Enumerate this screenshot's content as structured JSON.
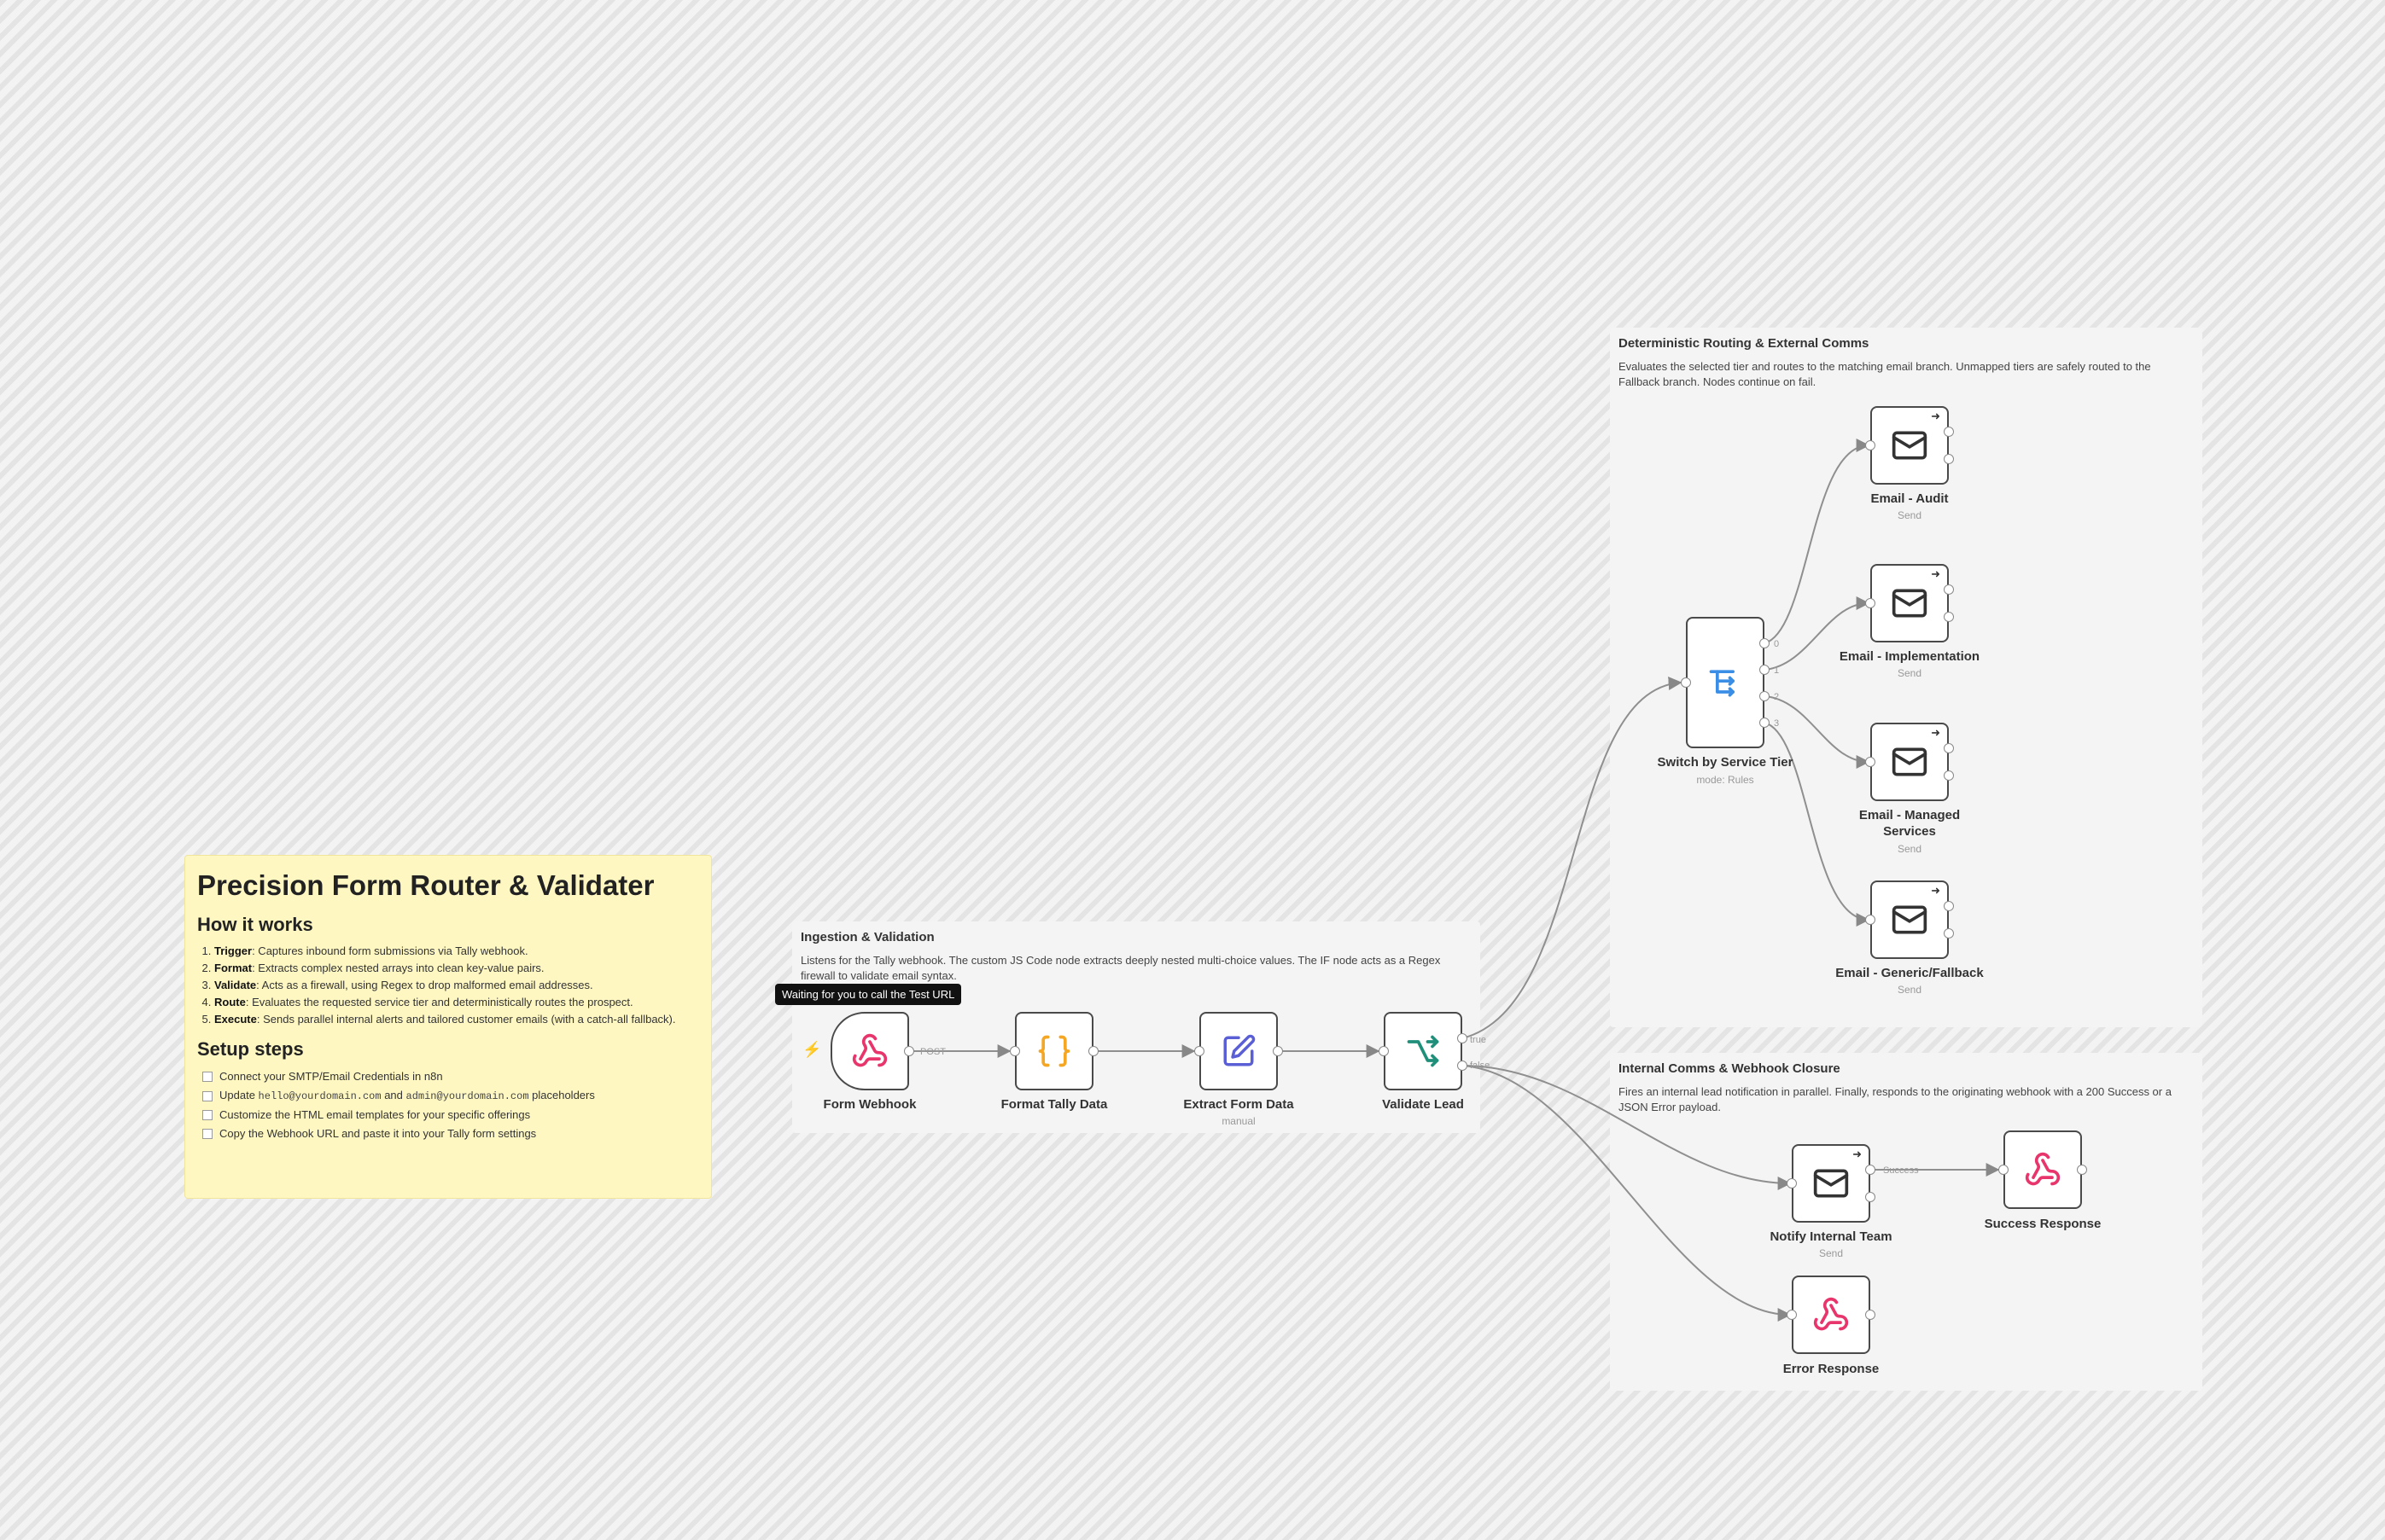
{
  "note": {
    "title": "Precision Form Router & Validater",
    "how_heading": "How it works",
    "steps": [
      {
        "bold": "Trigger",
        "text": ": Captures inbound form submissions via Tally webhook."
      },
      {
        "bold": "Format",
        "text": ": Extracts complex nested arrays into clean key-value pairs."
      },
      {
        "bold": "Validate",
        "text": ": Acts as a firewall, using Regex to drop malformed email addresses."
      },
      {
        "bold": "Route",
        "text": ": Evaluates the requested service tier and deterministically routes the prospect."
      },
      {
        "bold": "Execute",
        "text": ": Sends parallel internal alerts and tailored customer emails (with a catch-all fallback)."
      }
    ],
    "setup_heading": "Setup steps",
    "setup": {
      "item1": "Connect your SMTP/Email Credentials in n8n",
      "item2_pre": "Update ",
      "item2_code1": "hello@yourdomain.com",
      "item2_mid": " and ",
      "item2_code2": "admin@yourdomain.com",
      "item2_post": " placeholders",
      "item3": "Customize the HTML email templates for your specific offerings",
      "item4": "Copy the Webhook URL and paste it into your Tally form settings"
    }
  },
  "groups": {
    "ingestion": {
      "title": "Ingestion & Validation",
      "desc": "Listens for the Tally webhook. The custom JS Code node extracts deeply nested multi-choice values. The IF node acts as a Regex firewall to validate email syntax."
    },
    "routing": {
      "title": "Deterministic Routing & External Comms",
      "desc": "Evaluates the selected tier and routes to the matching email branch. Unmapped tiers are safely routed to the Fallback branch. Nodes continue on fail."
    },
    "internal": {
      "title": "Internal Comms & Webhook Closure",
      "desc": "Fires an internal lead notification in parallel. Finally, responds to the originating webhook with a 200 Success or a JSON Error payload."
    }
  },
  "tooltip": "Waiting for you to call the Test URL",
  "nodes": {
    "form_webhook": {
      "label": "Form Webhook",
      "icon": "webhook-icon"
    },
    "format_tally": {
      "label": "Format Tally Data",
      "icon": "code-braces-icon"
    },
    "extract_form": {
      "label": "Extract Form Data",
      "sub": "manual",
      "icon": "edit-icon"
    },
    "validate_lead": {
      "label": "Validate Lead",
      "icon": "if-branch-icon"
    },
    "switch": {
      "label": "Switch by Service Tier",
      "sub": "mode: Rules",
      "icon": "switch-icon"
    },
    "email_audit": {
      "label": "Email - Audit",
      "sub": "Send",
      "icon": "mail-icon"
    },
    "email_impl": {
      "label": "Email - Implementation",
      "sub": "Send",
      "icon": "mail-icon"
    },
    "email_managed": {
      "label": "Email - Managed Services",
      "sub": "Send",
      "icon": "mail-icon"
    },
    "email_generic": {
      "label": "Email - Generic/Fallback",
      "sub": "Send",
      "icon": "mail-icon"
    },
    "notify": {
      "label": "Notify Internal Team",
      "sub": "Send",
      "icon": "mail-icon"
    },
    "success": {
      "label": "Success Response",
      "icon": "webhook-icon"
    },
    "error": {
      "label": "Error Response",
      "icon": "webhook-icon"
    }
  },
  "edge_labels": {
    "post": "POST",
    "true": "true",
    "false": "false",
    "success": "Success",
    "out0": "0",
    "out1": "1",
    "out2": "2",
    "out3": "3"
  },
  "colors": {
    "webhook": "#e8366d",
    "code": "#f5a623",
    "edit": "#5b5fd6",
    "if": "#1f8f7a",
    "switch": "#3a8ee6",
    "mail": "#333333",
    "trigger_bolt": "#f0711c"
  }
}
